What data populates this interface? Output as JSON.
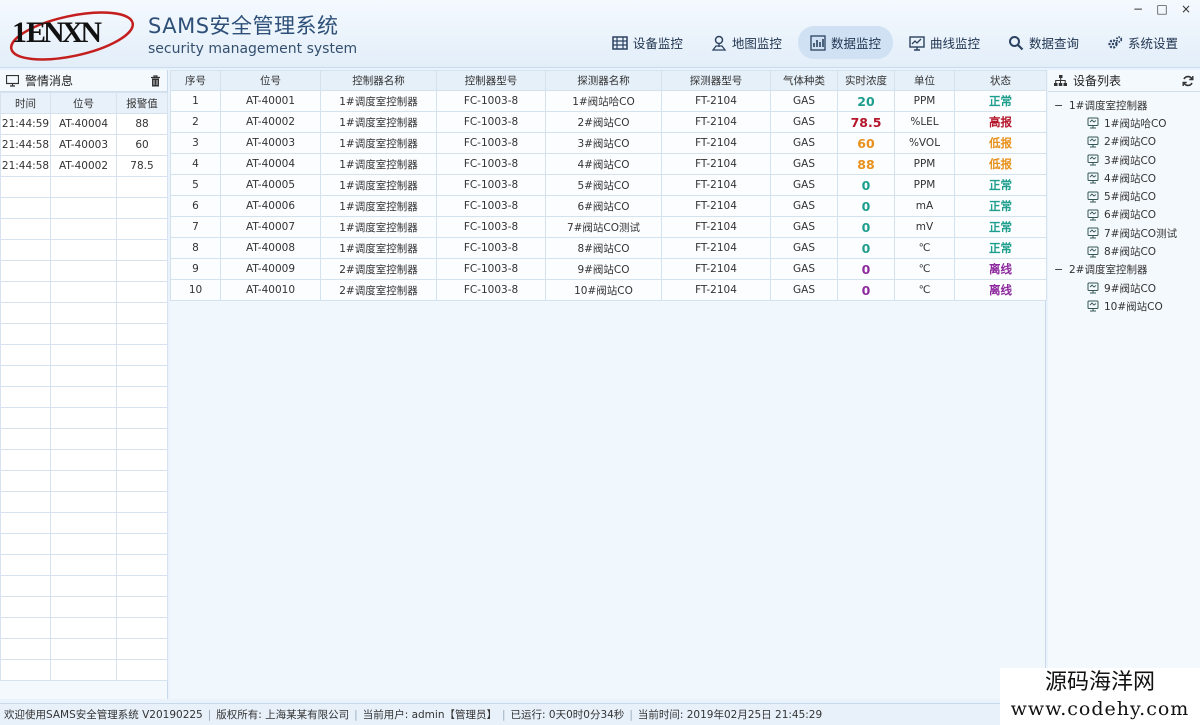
{
  "app": {
    "logo_text": "ENXN",
    "title_cn": "SAMS安全管理系统",
    "title_en": "security management system"
  },
  "window_controls": [
    "−",
    "□",
    "×"
  ],
  "nav": [
    {
      "label": "设备监控",
      "icon": "grid-icon",
      "active": false
    },
    {
      "label": "地图监控",
      "icon": "map-pin-icon",
      "active": false
    },
    {
      "label": "数据监控",
      "icon": "bar-chart-icon",
      "active": true
    },
    {
      "label": "曲线监控",
      "icon": "monitor-curve-icon",
      "active": false
    },
    {
      "label": "数据查询",
      "icon": "search-icon",
      "active": false
    },
    {
      "label": "系统设置",
      "icon": "gears-icon",
      "active": false
    }
  ],
  "alarm_panel": {
    "title": "警情消息",
    "columns": [
      "时间",
      "位号",
      "报警值"
    ],
    "rows": [
      [
        "21:44:59",
        "AT-40004",
        "88"
      ],
      [
        "21:44:58",
        "AT-40003",
        "60"
      ],
      [
        "21:44:58",
        "AT-40002",
        "78.5"
      ]
    ],
    "empty_rows": 24
  },
  "data_table": {
    "columns": [
      "序号",
      "位号",
      "控制器名称",
      "控制器型号",
      "探测器名称",
      "探测器型号",
      "气体种类",
      "实时浓度",
      "单位",
      "状态"
    ],
    "rows": [
      {
        "no": "1",
        "tag": "AT-40001",
        "ctrl": "1#调度室控制器",
        "ctrl_model": "FC-1003-8",
        "det": "1#阀站哈CO",
        "det_model": "FT-2104",
        "gas": "GAS",
        "val": "20",
        "unit": "PPM",
        "status": "正常"
      },
      {
        "no": "2",
        "tag": "AT-40002",
        "ctrl": "1#调度室控制器",
        "ctrl_model": "FC-1003-8",
        "det": "2#阀站CO",
        "det_model": "FT-2104",
        "gas": "GAS",
        "val": "78.5",
        "unit": "%LEL",
        "status": "高报"
      },
      {
        "no": "3",
        "tag": "AT-40003",
        "ctrl": "1#调度室控制器",
        "ctrl_model": "FC-1003-8",
        "det": "3#阀站CO",
        "det_model": "FT-2104",
        "gas": "GAS",
        "val": "60",
        "unit": "%VOL",
        "status": "低报"
      },
      {
        "no": "4",
        "tag": "AT-40004",
        "ctrl": "1#调度室控制器",
        "ctrl_model": "FC-1003-8",
        "det": "4#阀站CO",
        "det_model": "FT-2104",
        "gas": "GAS",
        "val": "88",
        "unit": "PPM",
        "status": "低报"
      },
      {
        "no": "5",
        "tag": "AT-40005",
        "ctrl": "1#调度室控制器",
        "ctrl_model": "FC-1003-8",
        "det": "5#阀站CO",
        "det_model": "FT-2104",
        "gas": "GAS",
        "val": "0",
        "unit": "PPM",
        "status": "正常"
      },
      {
        "no": "6",
        "tag": "AT-40006",
        "ctrl": "1#调度室控制器",
        "ctrl_model": "FC-1003-8",
        "det": "6#阀站CO",
        "det_model": "FT-2104",
        "gas": "GAS",
        "val": "0",
        "unit": "mA",
        "status": "正常"
      },
      {
        "no": "7",
        "tag": "AT-40007",
        "ctrl": "1#调度室控制器",
        "ctrl_model": "FC-1003-8",
        "det": "7#阀站CO测试",
        "det_model": "FT-2104",
        "gas": "GAS",
        "val": "0",
        "unit": "mV",
        "status": "正常"
      },
      {
        "no": "8",
        "tag": "AT-40008",
        "ctrl": "1#调度室控制器",
        "ctrl_model": "FC-1003-8",
        "det": "8#阀站CO",
        "det_model": "FT-2104",
        "gas": "GAS",
        "val": "0",
        "unit": "℃",
        "status": "正常"
      },
      {
        "no": "9",
        "tag": "AT-40009",
        "ctrl": "2#调度室控制器",
        "ctrl_model": "FC-1003-8",
        "det": "9#阀站CO",
        "det_model": "FT-2104",
        "gas": "GAS",
        "val": "0",
        "unit": "℃",
        "status": "离线"
      },
      {
        "no": "10",
        "tag": "AT-40010",
        "ctrl": "2#调度室控制器",
        "ctrl_model": "FC-1003-8",
        "det": "10#阀站CO",
        "det_model": "FT-2104",
        "gas": "GAS",
        "val": "0",
        "unit": "℃",
        "status": "离线"
      }
    ],
    "status_colors": {
      "正常": "#1e9e8c",
      "高报": "#b5162b",
      "低报": "#e8901a",
      "离线": "#8e2a9e"
    }
  },
  "device_tree": {
    "title": "设备列表",
    "controllers": [
      {
        "name": "1#调度室控制器",
        "detectors": [
          "1#阀站哈CO",
          "2#阀站CO",
          "3#阀站CO",
          "4#阀站CO",
          "5#阀站CO",
          "6#阀站CO",
          "7#阀站CO测试",
          "8#阀站CO"
        ]
      },
      {
        "name": "2#调度室控制器",
        "detectors": [
          "9#阀站CO",
          "10#阀站CO"
        ]
      }
    ]
  },
  "status_bar": {
    "welcome": "欢迎使用SAMS安全管理系统 V20190225",
    "copyright": "版权所有: 上海某某有限公司",
    "user": "当前用户: admin【管理员】",
    "uptime": "已运行: 0天0时0分34秒",
    "time": "当前时间: 2019年02月25日 21:45:29"
  },
  "watermark": {
    "line1": "源码海洋网",
    "line2": "www.codehy.com"
  }
}
